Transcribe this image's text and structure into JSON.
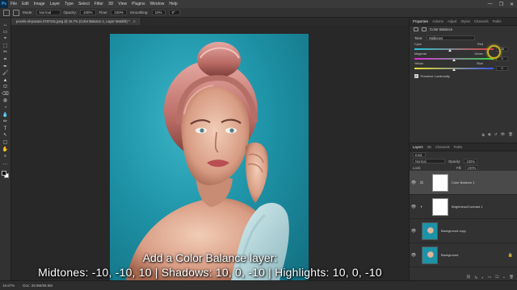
{
  "menu": {
    "logo": "Ps",
    "items": [
      "File",
      "Edit",
      "Image",
      "Layer",
      "Type",
      "Select",
      "Filter",
      "3D",
      "View",
      "Plugins",
      "Window",
      "Help"
    ],
    "window_controls": [
      "—",
      "❐",
      "✕"
    ]
  },
  "options_bar": {
    "mode_label": "Mode:",
    "mode_value": "Normal",
    "opacity_label": "Opacity:",
    "opacity_value": "100%",
    "flow_label": "Flow:",
    "flow_value": "100%",
    "smoothing_label": "Smoothing:",
    "smoothing_value": "10%",
    "angle_value": "0°"
  },
  "document_tab": {
    "title": "pexels-ali-pazani-2787341.jpeg @ 16.7% (Color Balance 1, Layer Mask/8) *"
  },
  "caption": {
    "line1": "Add a Color Balance layer:",
    "line2": "Midtones: -10, -10, 10  |  Shadows: 10, 0, -10  |  Highlights: 10, 0, -10"
  },
  "status": {
    "zoom": "16.67%",
    "doc_size": "Doc: 28.9M/58.5M"
  },
  "properties_panel": {
    "tabs": [
      "Properties",
      "Actions",
      "Adjust",
      "Styles",
      "Channels",
      "Paths",
      "Brushes",
      "Actions"
    ],
    "header_label": "Color Balance",
    "tone_label": "Tone:",
    "tone_value": "Midtones",
    "sliders": [
      {
        "left": "Cyan",
        "right": "Red",
        "value": -10,
        "display": "-10",
        "color_left": "#23c8d8",
        "color_right": "#e23b3b"
      },
      {
        "left": "Magenta",
        "right": "Green",
        "value": 0,
        "display": "0",
        "color_left": "#d92ed9",
        "color_right": "#2ed94a"
      },
      {
        "left": "Yellow",
        "right": "Blue",
        "value": 0,
        "display": "0",
        "color_left": "#e8de2a",
        "color_right": "#3a55e8"
      }
    ],
    "preserve_luminosity": "Preserve Luminosity",
    "footer_icons": [
      "⧉",
      "◉",
      "↺",
      "👁",
      "🗑"
    ]
  },
  "layers_panel": {
    "tabs": [
      "Layers",
      "3D",
      "Channels",
      "Paths"
    ],
    "kind_label": "Kind",
    "blend_mode": "Normal",
    "opacity_label": "Opacity:",
    "opacity_value": "100%",
    "lock_label": "Lock:",
    "fill_label": "Fill:",
    "fill_value": "100%",
    "layers": [
      {
        "name": "Color Balance 1",
        "type": "adjustment",
        "icon": "⚖",
        "selected": true
      },
      {
        "name": "Brightness/Contrast 1",
        "type": "adjustment",
        "icon": "◐",
        "selected": false
      },
      {
        "name": "Background copy",
        "type": "image",
        "selected": false
      },
      {
        "name": "Background",
        "type": "image",
        "selected": false,
        "locked": true
      }
    ],
    "footer_icons": [
      "⛓",
      "fx",
      "◐",
      "▭",
      "🗀",
      "+",
      "🗑"
    ]
  },
  "tool_icons": [
    "↔",
    "▭",
    "⌖",
    "⬚",
    "✂",
    "⌗",
    "✒",
    "🖌",
    "▲",
    "⛫",
    "⌫",
    "◍",
    "◔",
    "💧",
    "✏",
    "T",
    "↖",
    "▢",
    "✋",
    "⌕",
    "…"
  ],
  "colors": {
    "accent": "#31a8ff",
    "background_teal": "#1f94a8",
    "cursor_ring": "#c9b21c"
  }
}
